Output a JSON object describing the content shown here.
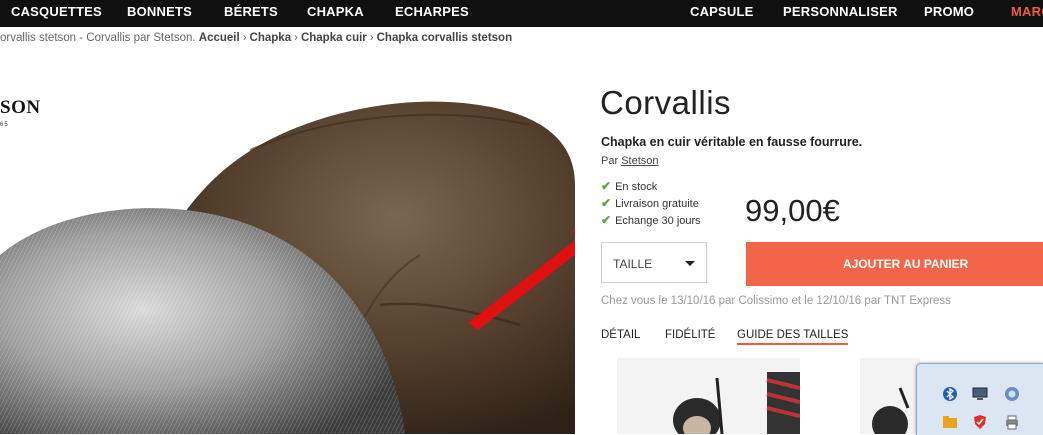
{
  "nav": {
    "left": [
      "CASQUETTES",
      "BONNETS",
      "BÉRETS",
      "CHAPKA",
      "ECHARPES"
    ],
    "right": [
      "CAPSULE",
      "PERSONNALISER",
      "PROMO",
      "MARQ"
    ]
  },
  "breadcrumb": {
    "current_text": "orvallis stetson - Corvallis par Stetson.",
    "links": [
      "Accueil",
      "Chapka",
      "Chapka cuir",
      "Chapka corvallis stetson"
    ]
  },
  "brand_logo": {
    "text": "SON",
    "sub": "65"
  },
  "product": {
    "title": "Corvallis",
    "subtitle": "Chapka en cuir véritable en fausse fourrure.",
    "by_prefix": "Par",
    "brand": "Stetson",
    "features": [
      "En stock",
      "Livraison gratuite",
      "Echange 30 jours"
    ],
    "price": "99,00€",
    "size_select": "TAILLE",
    "add_to_cart": "AJOUTER AU PANIER",
    "delivery": "Chez vous le 13/10/16 par Colissimo et le 12/10/16 par TNT Express"
  },
  "tabs": [
    "DÉTAIL",
    "FIDÉLITÉ",
    "GUIDE DES TAILLES"
  ],
  "active_tab": "GUIDE DES TAILLES",
  "colors": {
    "accent": "#f26548",
    "nav_bg": "#101010",
    "check": "#5aa63c"
  },
  "icons": [
    "check-icon",
    "chevron-down-icon",
    "bluetooth-icon",
    "monitor-icon",
    "network-icon",
    "folder-icon",
    "shield-icon",
    "printer-icon"
  ]
}
